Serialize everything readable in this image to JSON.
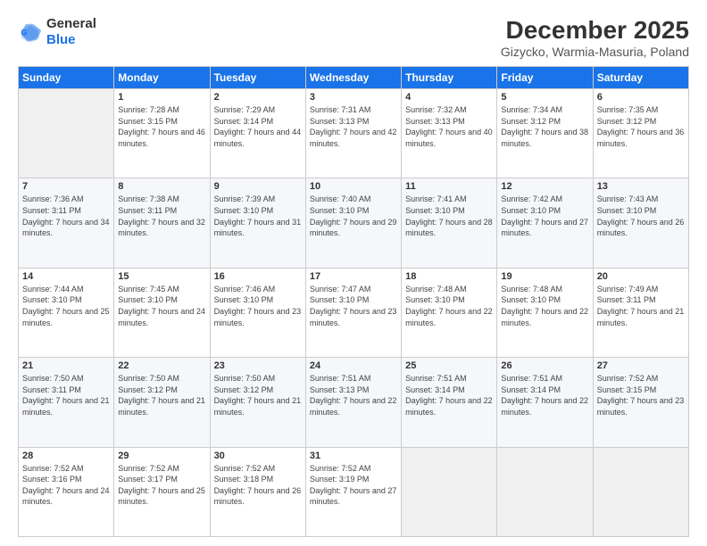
{
  "header": {
    "logo_general": "General",
    "logo_blue": "Blue",
    "month_title": "December 2025",
    "subtitle": "Gizycko, Warmia-Masuria, Poland"
  },
  "days_of_week": [
    "Sunday",
    "Monday",
    "Tuesday",
    "Wednesday",
    "Thursday",
    "Friday",
    "Saturday"
  ],
  "weeks": [
    [
      {
        "day": "",
        "sunrise": "",
        "sunset": "",
        "daylight": ""
      },
      {
        "day": "1",
        "sunrise": "Sunrise: 7:28 AM",
        "sunset": "Sunset: 3:15 PM",
        "daylight": "Daylight: 7 hours and 46 minutes."
      },
      {
        "day": "2",
        "sunrise": "Sunrise: 7:29 AM",
        "sunset": "Sunset: 3:14 PM",
        "daylight": "Daylight: 7 hours and 44 minutes."
      },
      {
        "day": "3",
        "sunrise": "Sunrise: 7:31 AM",
        "sunset": "Sunset: 3:13 PM",
        "daylight": "Daylight: 7 hours and 42 minutes."
      },
      {
        "day": "4",
        "sunrise": "Sunrise: 7:32 AM",
        "sunset": "Sunset: 3:13 PM",
        "daylight": "Daylight: 7 hours and 40 minutes."
      },
      {
        "day": "5",
        "sunrise": "Sunrise: 7:34 AM",
        "sunset": "Sunset: 3:12 PM",
        "daylight": "Daylight: 7 hours and 38 minutes."
      },
      {
        "day": "6",
        "sunrise": "Sunrise: 7:35 AM",
        "sunset": "Sunset: 3:12 PM",
        "daylight": "Daylight: 7 hours and 36 minutes."
      }
    ],
    [
      {
        "day": "7",
        "sunrise": "Sunrise: 7:36 AM",
        "sunset": "Sunset: 3:11 PM",
        "daylight": "Daylight: 7 hours and 34 minutes."
      },
      {
        "day": "8",
        "sunrise": "Sunrise: 7:38 AM",
        "sunset": "Sunset: 3:11 PM",
        "daylight": "Daylight: 7 hours and 32 minutes."
      },
      {
        "day": "9",
        "sunrise": "Sunrise: 7:39 AM",
        "sunset": "Sunset: 3:10 PM",
        "daylight": "Daylight: 7 hours and 31 minutes."
      },
      {
        "day": "10",
        "sunrise": "Sunrise: 7:40 AM",
        "sunset": "Sunset: 3:10 PM",
        "daylight": "Daylight: 7 hours and 29 minutes."
      },
      {
        "day": "11",
        "sunrise": "Sunrise: 7:41 AM",
        "sunset": "Sunset: 3:10 PM",
        "daylight": "Daylight: 7 hours and 28 minutes."
      },
      {
        "day": "12",
        "sunrise": "Sunrise: 7:42 AM",
        "sunset": "Sunset: 3:10 PM",
        "daylight": "Daylight: 7 hours and 27 minutes."
      },
      {
        "day": "13",
        "sunrise": "Sunrise: 7:43 AM",
        "sunset": "Sunset: 3:10 PM",
        "daylight": "Daylight: 7 hours and 26 minutes."
      }
    ],
    [
      {
        "day": "14",
        "sunrise": "Sunrise: 7:44 AM",
        "sunset": "Sunset: 3:10 PM",
        "daylight": "Daylight: 7 hours and 25 minutes."
      },
      {
        "day": "15",
        "sunrise": "Sunrise: 7:45 AM",
        "sunset": "Sunset: 3:10 PM",
        "daylight": "Daylight: 7 hours and 24 minutes."
      },
      {
        "day": "16",
        "sunrise": "Sunrise: 7:46 AM",
        "sunset": "Sunset: 3:10 PM",
        "daylight": "Daylight: 7 hours and 23 minutes."
      },
      {
        "day": "17",
        "sunrise": "Sunrise: 7:47 AM",
        "sunset": "Sunset: 3:10 PM",
        "daylight": "Daylight: 7 hours and 23 minutes."
      },
      {
        "day": "18",
        "sunrise": "Sunrise: 7:48 AM",
        "sunset": "Sunset: 3:10 PM",
        "daylight": "Daylight: 7 hours and 22 minutes."
      },
      {
        "day": "19",
        "sunrise": "Sunrise: 7:48 AM",
        "sunset": "Sunset: 3:10 PM",
        "daylight": "Daylight: 7 hours and 22 minutes."
      },
      {
        "day": "20",
        "sunrise": "Sunrise: 7:49 AM",
        "sunset": "Sunset: 3:11 PM",
        "daylight": "Daylight: 7 hours and 21 minutes."
      }
    ],
    [
      {
        "day": "21",
        "sunrise": "Sunrise: 7:50 AM",
        "sunset": "Sunset: 3:11 PM",
        "daylight": "Daylight: 7 hours and 21 minutes."
      },
      {
        "day": "22",
        "sunrise": "Sunrise: 7:50 AM",
        "sunset": "Sunset: 3:12 PM",
        "daylight": "Daylight: 7 hours and 21 minutes."
      },
      {
        "day": "23",
        "sunrise": "Sunrise: 7:50 AM",
        "sunset": "Sunset: 3:12 PM",
        "daylight": "Daylight: 7 hours and 21 minutes."
      },
      {
        "day": "24",
        "sunrise": "Sunrise: 7:51 AM",
        "sunset": "Sunset: 3:13 PM",
        "daylight": "Daylight: 7 hours and 22 minutes."
      },
      {
        "day": "25",
        "sunrise": "Sunrise: 7:51 AM",
        "sunset": "Sunset: 3:14 PM",
        "daylight": "Daylight: 7 hours and 22 minutes."
      },
      {
        "day": "26",
        "sunrise": "Sunrise: 7:51 AM",
        "sunset": "Sunset: 3:14 PM",
        "daylight": "Daylight: 7 hours and 22 minutes."
      },
      {
        "day": "27",
        "sunrise": "Sunrise: 7:52 AM",
        "sunset": "Sunset: 3:15 PM",
        "daylight": "Daylight: 7 hours and 23 minutes."
      }
    ],
    [
      {
        "day": "28",
        "sunrise": "Sunrise: 7:52 AM",
        "sunset": "Sunset: 3:16 PM",
        "daylight": "Daylight: 7 hours and 24 minutes."
      },
      {
        "day": "29",
        "sunrise": "Sunrise: 7:52 AM",
        "sunset": "Sunset: 3:17 PM",
        "daylight": "Daylight: 7 hours and 25 minutes."
      },
      {
        "day": "30",
        "sunrise": "Sunrise: 7:52 AM",
        "sunset": "Sunset: 3:18 PM",
        "daylight": "Daylight: 7 hours and 26 minutes."
      },
      {
        "day": "31",
        "sunrise": "Sunrise: 7:52 AM",
        "sunset": "Sunset: 3:19 PM",
        "daylight": "Daylight: 7 hours and 27 minutes."
      },
      {
        "day": "",
        "sunrise": "",
        "sunset": "",
        "daylight": ""
      },
      {
        "day": "",
        "sunrise": "",
        "sunset": "",
        "daylight": ""
      },
      {
        "day": "",
        "sunrise": "",
        "sunset": "",
        "daylight": ""
      }
    ]
  ]
}
